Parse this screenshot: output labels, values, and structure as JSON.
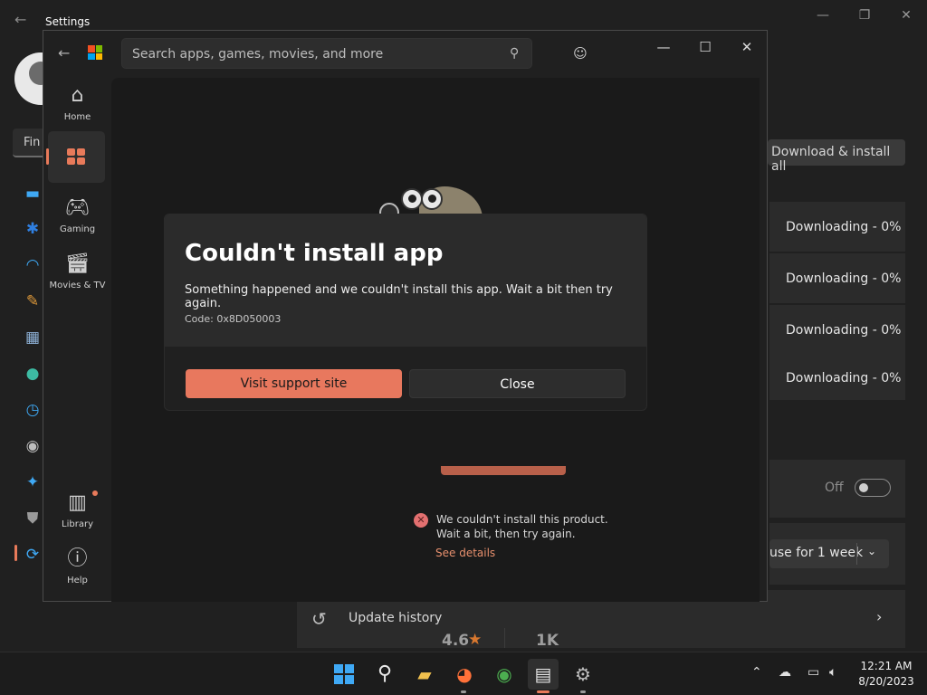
{
  "settings": {
    "title": "Settings",
    "find_text": "Fin",
    "download_all_label": "Download & install all",
    "downloads": [
      "Downloading - 0%",
      "Downloading - 0%",
      "Downloading - 0%",
      "Downloading - 0%"
    ],
    "toggle_label": "Off",
    "pause_label": "use for 1 week",
    "update_history_label": "Update history"
  },
  "store": {
    "search_placeholder": "Search apps, games, movies, and more",
    "nav": {
      "home": "Home",
      "gaming": "Gaming",
      "movies": "Movies & TV",
      "library": "Library",
      "help": "Help"
    },
    "error_line1": "We couldn't install this product.",
    "error_line2": "Wait a bit, then try again.",
    "see_details": "See details",
    "rating": "4.6",
    "rating_count": "1K"
  },
  "dialog": {
    "title": "Couldn't install app",
    "message": "Something happened and we couldn't install this app. Wait a bit then try again.",
    "code": "Code: 0x8D050003",
    "primary_button": "Visit support site",
    "secondary_button": "Close"
  },
  "taskbar": {
    "time": "12:21 AM",
    "date": "8/20/2023"
  },
  "colors": {
    "accent": "#e8785e",
    "windows_blue": "#3fa9f5"
  }
}
